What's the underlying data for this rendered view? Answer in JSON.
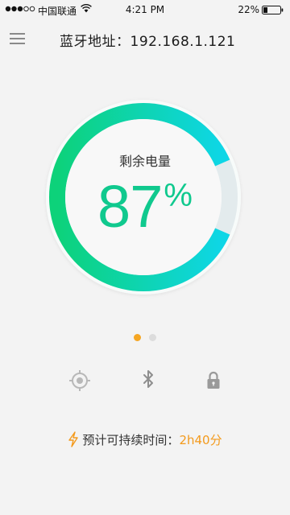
{
  "status_bar": {
    "carrier": "中国联通",
    "time": "4:21 PM",
    "battery_text": "22%"
  },
  "header": {
    "title": "蓝牙地址：192.168.1.121",
    "menu_icon": "hamburger-menu-icon"
  },
  "gauge": {
    "label": "剩余电量",
    "value": "87",
    "unit": "%",
    "level": 0.87,
    "colors": {
      "start": "#0dd27a",
      "end": "#0ed6e6",
      "track": "#e3ebed"
    }
  },
  "pager": {
    "count": 2,
    "active_index": 0,
    "active_color": "#f5a623"
  },
  "actions": [
    {
      "icon": "locate-icon"
    },
    {
      "icon": "bluetooth-icon"
    },
    {
      "icon": "lock-icon"
    }
  ],
  "estimate": {
    "icon": "lightning-icon",
    "label": "预计可持续时间：",
    "value": "2h40分",
    "accent": "#f39a1c"
  }
}
